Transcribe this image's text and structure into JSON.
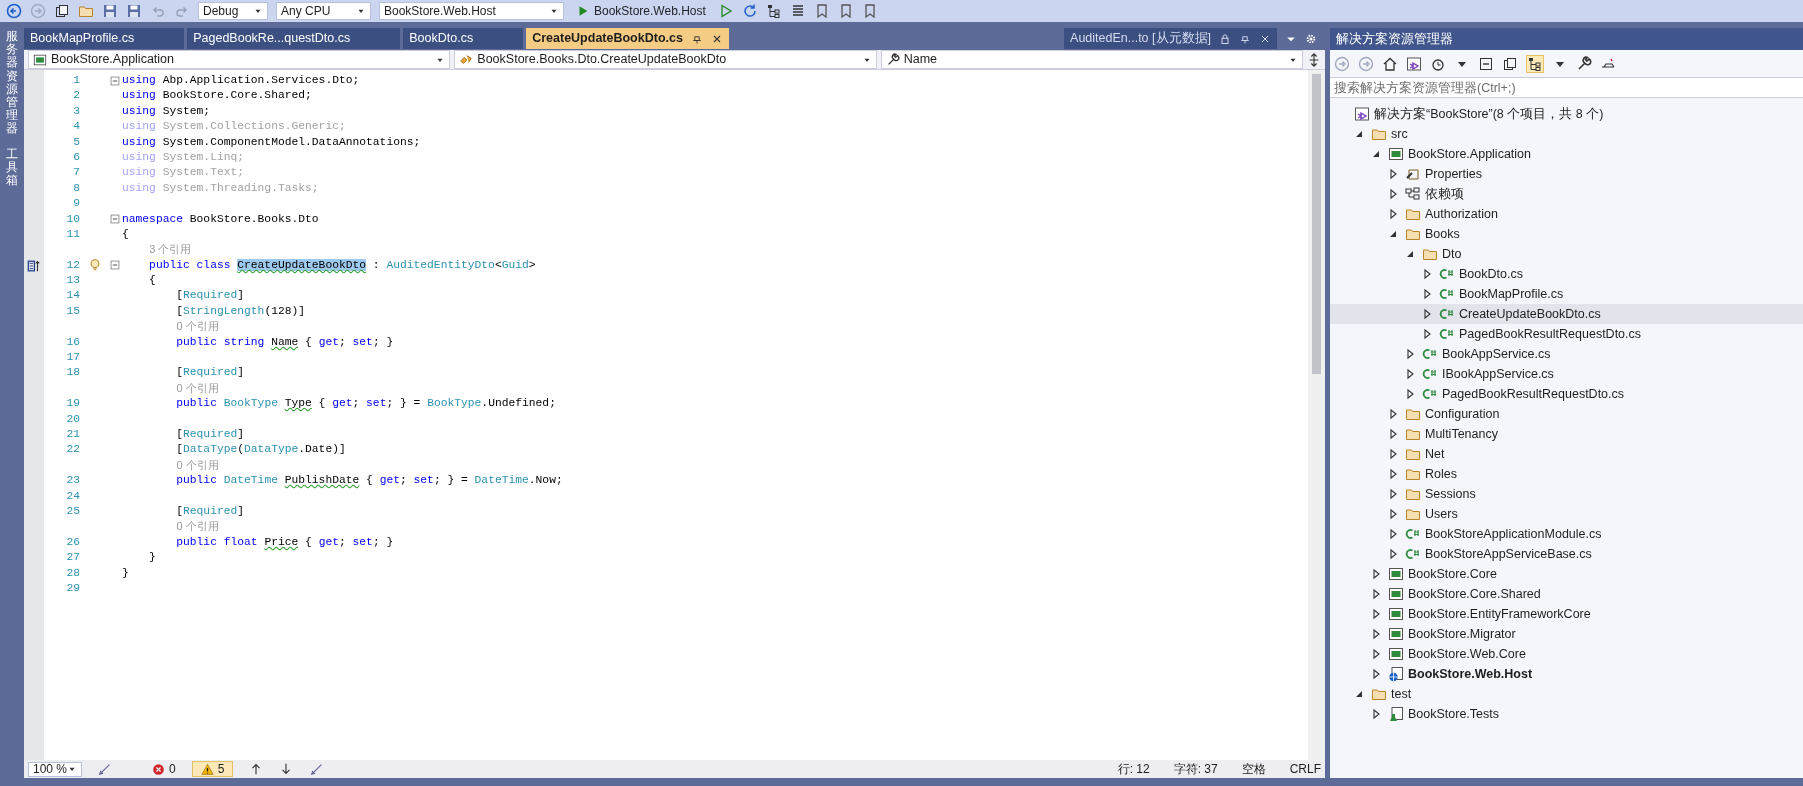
{
  "toolbar": {
    "configuration": "Debug",
    "platform": "Any CPU",
    "startup_project": "BookStore.Web.Host",
    "run_button": "BookStore.Web.Host"
  },
  "side_tool_windows": [
    "服务器资源管理器",
    "工具箱"
  ],
  "tabs": [
    {
      "label": "BookMapProfile.cs",
      "selected": false
    },
    {
      "label": "PagedBookRe...questDto.cs",
      "selected": false
    },
    {
      "label": "BookDto.cs",
      "selected": false
    },
    {
      "label": "CreateUpdateBookDto.cs",
      "selected": true
    }
  ],
  "preview_tab": {
    "label": "AuditedEn...to [从元数据]"
  },
  "navigation_bar": {
    "project": "BookStore.Application",
    "type": "BookStore.Books.Dto.CreateUpdateBookDto",
    "member": "Name"
  },
  "code_lines": [
    {
      "kind": "code",
      "number": "1",
      "faded": false,
      "fold": true,
      "tokens": [
        {
          "kind": "keyword",
          "text": "using"
        },
        {
          "kind": "text",
          "text": " Abp.Application.Services.Dto;"
        }
      ]
    },
    {
      "kind": "code",
      "number": "2",
      "faded": false,
      "fold": false,
      "tokens": [
        {
          "kind": "keyword",
          "text": "using"
        },
        {
          "kind": "text",
          "text": " BookStore.Core.Shared;"
        }
      ]
    },
    {
      "kind": "code",
      "number": "3",
      "faded": false,
      "fold": false,
      "tokens": [
        {
          "kind": "keyword",
          "text": "using"
        },
        {
          "kind": "text",
          "text": " System;"
        }
      ]
    },
    {
      "kind": "code",
      "number": "4",
      "faded": true,
      "fold": false,
      "tokens": [
        {
          "kind": "keyword",
          "text": "using"
        },
        {
          "kind": "text",
          "text": " System.Collections.Generic;"
        }
      ]
    },
    {
      "kind": "code",
      "number": "5",
      "faded": false,
      "fold": false,
      "tokens": [
        {
          "kind": "keyword",
          "text": "using"
        },
        {
          "kind": "text",
          "text": " System.ComponentModel.DataAnnotations;"
        }
      ]
    },
    {
      "kind": "code",
      "number": "6",
      "faded": true,
      "fold": false,
      "tokens": [
        {
          "kind": "keyword",
          "text": "using"
        },
        {
          "kind": "text",
          "text": " System.Linq;"
        }
      ]
    },
    {
      "kind": "code",
      "number": "7",
      "faded": true,
      "fold": false,
      "tokens": [
        {
          "kind": "keyword",
          "text": "using"
        },
        {
          "kind": "text",
          "text": " System.Text;"
        }
      ]
    },
    {
      "kind": "code",
      "number": "8",
      "faded": true,
      "fold": false,
      "tokens": [
        {
          "kind": "keyword",
          "text": "using"
        },
        {
          "kind": "text",
          "text": " System.Threading.Tasks;"
        }
      ]
    },
    {
      "kind": "code",
      "number": "9"
    },
    {
      "kind": "code",
      "number": "10",
      "faded": false,
      "fold": true,
      "tokens": [
        {
          "kind": "keyword",
          "text": "namespace"
        },
        {
          "kind": "text",
          "text": " BookStore.Books.Dto"
        }
      ]
    },
    {
      "kind": "code",
      "number": "11",
      "faded": false,
      "fold": false,
      "tokens": [
        {
          "kind": "text",
          "text": "{"
        }
      ]
    },
    {
      "kind": "codelens",
      "text": "3 个引用"
    },
    {
      "kind": "code",
      "number": "12",
      "faded": false,
      "fold": true,
      "tokens": [
        {
          "kind": "keyword",
          "text": "    public class "
        },
        {
          "kind": "selection",
          "text": "CreateUpdateBookDto"
        },
        {
          "kind": "text",
          "text": " : "
        },
        {
          "kind": "type",
          "text": "AuditedEntityDto"
        },
        {
          "kind": "text",
          "text": "<"
        },
        {
          "kind": "type",
          "text": "Guid"
        },
        {
          "kind": "text",
          "text": ">"
        }
      ]
    },
    {
      "kind": "code",
      "number": "13",
      "faded": false,
      "fold": false,
      "tokens": [
        {
          "kind": "text",
          "text": "    {"
        }
      ]
    },
    {
      "kind": "code",
      "number": "14",
      "faded": false,
      "fold": false,
      "tokens": [
        {
          "kind": "text",
          "text": "        ["
        },
        {
          "kind": "type",
          "text": "Required"
        },
        {
          "kind": "text",
          "text": "]"
        }
      ]
    },
    {
      "kind": "code",
      "number": "15",
      "faded": false,
      "fold": false,
      "tokens": [
        {
          "kind": "text",
          "text": "        ["
        },
        {
          "kind": "type",
          "text": "StringLength"
        },
        {
          "kind": "text",
          "text": "(128)]"
        }
      ]
    },
    {
      "kind": "codelens",
      "text": "0 个引用"
    },
    {
      "kind": "code",
      "number": "16",
      "faded": false,
      "fold": false,
      "tokens": [
        {
          "kind": "keyword",
          "text": "        public string "
        },
        {
          "kind": "warned",
          "text": "Name"
        },
        {
          "kind": "text",
          "text": " { "
        },
        {
          "kind": "keyword",
          "text": "get"
        },
        {
          "kind": "text",
          "text": "; "
        },
        {
          "kind": "keyword",
          "text": "set"
        },
        {
          "kind": "text",
          "text": "; }"
        }
      ]
    },
    {
      "kind": "code",
      "number": "17"
    },
    {
      "kind": "code",
      "number": "18",
      "faded": false,
      "fold": false,
      "tokens": [
        {
          "kind": "text",
          "text": "        ["
        },
        {
          "kind": "type",
          "text": "Required"
        },
        {
          "kind": "text",
          "text": "]"
        }
      ]
    },
    {
      "kind": "codelens",
      "text": "0 个引用"
    },
    {
      "kind": "code",
      "number": "19",
      "faded": false,
      "fold": false,
      "tokens": [
        {
          "kind": "keyword",
          "text": "        public "
        },
        {
          "kind": "type",
          "text": "BookType "
        },
        {
          "kind": "warned",
          "text": "Type"
        },
        {
          "kind": "text",
          "text": " { "
        },
        {
          "kind": "keyword",
          "text": "get"
        },
        {
          "kind": "text",
          "text": "; "
        },
        {
          "kind": "keyword",
          "text": "set"
        },
        {
          "kind": "text",
          "text": "; } = "
        },
        {
          "kind": "type",
          "text": "BookType"
        },
        {
          "kind": "text",
          "text": ".Undefined;"
        }
      ]
    },
    {
      "kind": "code",
      "number": "20"
    },
    {
      "kind": "code",
      "number": "21",
      "faded": false,
      "fold": false,
      "tokens": [
        {
          "kind": "text",
          "text": "        ["
        },
        {
          "kind": "type",
          "text": "Required"
        },
        {
          "kind": "text",
          "text": "]"
        }
      ]
    },
    {
      "kind": "code",
      "number": "22",
      "faded": false,
      "fold": false,
      "tokens": [
        {
          "kind": "text",
          "text": "        ["
        },
        {
          "kind": "type",
          "text": "DataType"
        },
        {
          "kind": "text",
          "text": "("
        },
        {
          "kind": "type",
          "text": "DataType"
        },
        {
          "kind": "text",
          "text": ".Date)]"
        }
      ]
    },
    {
      "kind": "codelens",
      "text": "0 个引用"
    },
    {
      "kind": "code",
      "number": "23",
      "faded": false,
      "fold": false,
      "tokens": [
        {
          "kind": "keyword",
          "text": "        public "
        },
        {
          "kind": "type",
          "text": "DateTime "
        },
        {
          "kind": "warned",
          "text": "PublishDate"
        },
        {
          "kind": "text",
          "text": " { "
        },
        {
          "kind": "keyword",
          "text": "get"
        },
        {
          "kind": "text",
          "text": "; "
        },
        {
          "kind": "keyword",
          "text": "set"
        },
        {
          "kind": "text",
          "text": "; } = "
        },
        {
          "kind": "type",
          "text": "DateTime"
        },
        {
          "kind": "text",
          "text": ".Now;"
        }
      ]
    },
    {
      "kind": "code",
      "number": "24"
    },
    {
      "kind": "code",
      "number": "25",
      "faded": false,
      "fold": false,
      "tokens": [
        {
          "kind": "text",
          "text": "        ["
        },
        {
          "kind": "type",
          "text": "Required"
        },
        {
          "kind": "text",
          "text": "]"
        }
      ]
    },
    {
      "kind": "codelens",
      "text": "0 个引用"
    },
    {
      "kind": "code",
      "number": "26",
      "faded": false,
      "fold": false,
      "tokens": [
        {
          "kind": "keyword",
          "text": "        public float "
        },
        {
          "kind": "warned",
          "text": "Price"
        },
        {
          "kind": "text",
          "text": " { "
        },
        {
          "kind": "keyword",
          "text": "get"
        },
        {
          "kind": "text",
          "text": "; "
        },
        {
          "kind": "keyword",
          "text": "set"
        },
        {
          "kind": "text",
          "text": "; }"
        }
      ]
    },
    {
      "kind": "code",
      "number": "27",
      "faded": false,
      "fold": false,
      "tokens": [
        {
          "kind": "text",
          "text": "    }"
        }
      ]
    },
    {
      "kind": "code",
      "number": "28",
      "faded": false,
      "fold": false,
      "tokens": [
        {
          "kind": "text",
          "text": "}"
        }
      ]
    },
    {
      "kind": "code",
      "number": "29"
    }
  ],
  "status_bar": {
    "zoom": "100 %",
    "errors": "0",
    "warnings": "5",
    "line": "行: 12",
    "column": "字符: 37",
    "indent_mode": "空格",
    "line_ending": "CRLF"
  },
  "solution_explorer": {
    "title": "解决方案资源管理器",
    "search": {
      "placeholder": "搜索解决方案资源管理器(Ctrl+;)"
    },
    "tree": [
      {
        "label": "解决方案“BookStore”(8 个项目，共 8 个)",
        "kind": "solution",
        "selected": false,
        "children": [
          {
            "label": "src",
            "kind": "folder",
            "selected": false,
            "expanded": true,
            "children": [
              {
                "label": "BookStore.Application",
                "kind": "project",
                "selected": false,
                "expanded": true,
                "children": [
                  {
                    "label": "Properties",
                    "kind": "properties",
                    "selected": false,
                    "expanded": false
                  },
                  {
                    "label": "依赖项",
                    "kind": "references",
                    "selected": false,
                    "expanded": false
                  },
                  {
                    "label": "Authorization",
                    "kind": "folder",
                    "selected": false,
                    "expanded": false
                  },
                  {
                    "label": "Books",
                    "kind": "folder",
                    "selected": false,
                    "expanded": true,
                    "children": [
                      {
                        "label": "Dto",
                        "kind": "folder",
                        "selected": false,
                        "expanded": true,
                        "children": [
                          {
                            "label": "BookDto.cs",
                            "kind": "code-file",
                            "selected": false,
                            "expanded": false
                          },
                          {
                            "label": "BookMapProfile.cs",
                            "kind": "code-file",
                            "selected": false,
                            "expanded": false
                          },
                          {
                            "label": "CreateUpdateBookDto.cs",
                            "kind": "code-file",
                            "selected": true,
                            "expanded": false
                          },
                          {
                            "label": "PagedBookResultRequestDto.cs",
                            "kind": "code-file",
                            "selected": false,
                            "expanded": false
                          }
                        ]
                      },
                      {
                        "label": "BookAppService.cs",
                        "kind": "code-file",
                        "selected": false,
                        "expanded": false
                      },
                      {
                        "label": "IBookAppService.cs",
                        "kind": "code-file",
                        "selected": false,
                        "expanded": false
                      },
                      {
                        "label": "PagedBookResultRequestDto.cs",
                        "kind": "code-file",
                        "selected": false,
                        "expanded": false
                      }
                    ]
                  },
                  {
                    "label": "Configuration",
                    "kind": "folder",
                    "selected": false,
                    "expanded": false
                  },
                  {
                    "label": "MultiTenancy",
                    "kind": "folder",
                    "selected": false,
                    "expanded": false
                  },
                  {
                    "label": "Net",
                    "kind": "folder",
                    "selected": false,
                    "expanded": false
                  },
                  {
                    "label": "Roles",
                    "kind": "folder",
                    "selected": false,
                    "expanded": false
                  },
                  {
                    "label": "Sessions",
                    "kind": "folder",
                    "selected": false,
                    "expanded": false
                  },
                  {
                    "label": "Users",
                    "kind": "folder",
                    "selected": false,
                    "expanded": false
                  },
                  {
                    "label": "BookStoreApplicationModule.cs",
                    "kind": "code-file",
                    "selected": false,
                    "expanded": false
                  },
                  {
                    "label": "BookStoreAppServiceBase.cs",
                    "kind": "code-file",
                    "selected": false,
                    "expanded": false
                  }
                ]
              },
              {
                "label": "BookStore.Core",
                "kind": "project",
                "selected": false,
                "expanded": false
              },
              {
                "label": "BookStore.Core.Shared",
                "kind": "project",
                "selected": false,
                "expanded": false
              },
              {
                "label": "BookStore.EntityFrameworkCore",
                "kind": "project",
                "selected": false,
                "expanded": false
              },
              {
                "label": "BookStore.Migrator",
                "kind": "project",
                "selected": false,
                "expanded": false
              },
              {
                "label": "BookStore.Web.Core",
                "kind": "project",
                "selected": false,
                "expanded": false
              },
              {
                "label": "BookStore.Web.Host",
                "kind": "startup-project",
                "selected": false,
                "expanded": false
              }
            ]
          },
          {
            "label": "test",
            "kind": "folder",
            "selected": false,
            "expanded": true,
            "children": [
              {
                "label": "BookStore.Tests",
                "kind": "test-project",
                "selected": false,
                "expanded": false
              }
            ]
          }
        ]
      }
    ]
  }
}
